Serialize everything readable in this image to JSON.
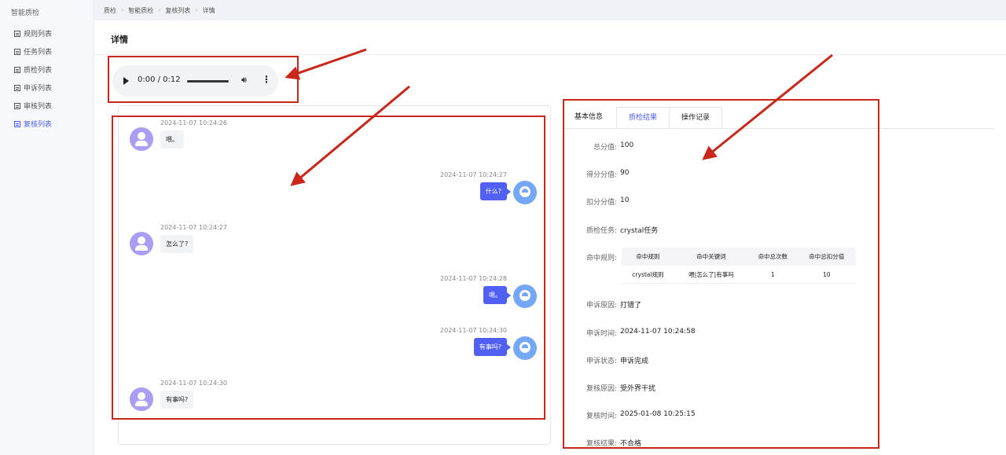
{
  "sidebar": {
    "title": "智能质检",
    "items": [
      {
        "label": "规则列表"
      },
      {
        "label": "任务列表"
      },
      {
        "label": "质检列表"
      },
      {
        "label": "申诉列表"
      },
      {
        "label": "审核列表"
      },
      {
        "label": "复核列表",
        "active": true
      }
    ]
  },
  "breadcrumb": [
    "质检",
    "智能质检",
    "复核列表",
    "详情"
  ],
  "page_title": "详情",
  "audio": {
    "time": "0:00 / 0:12",
    "progress": 0
  },
  "messages": [
    {
      "side": "left",
      "time": "2024-11-07 10:24:26",
      "text": "喂。"
    },
    {
      "side": "right",
      "time": "2024-11-07 10:24:27",
      "text": "什么?"
    },
    {
      "side": "left",
      "time": "2024-11-07 10:24:27",
      "text": "怎么了?"
    },
    {
      "side": "right",
      "time": "2024-11-07 10:24:28",
      "text": "嗯。"
    },
    {
      "side": "right",
      "time": "2024-11-07 10:24:30",
      "text": "有事吗?"
    },
    {
      "side": "left",
      "time": "2024-11-07 10:24:30",
      "text": "有事吗?"
    }
  ],
  "tabs": [
    "基本信息",
    "质检结果",
    "操作记录"
  ],
  "active_tab": "质检结果",
  "result": {
    "total_label": "总分值:",
    "total": "100",
    "score_label": "得分分值:",
    "score": "90",
    "deduct_label": "扣分分值:",
    "deduct": "10",
    "task_label": "质检任务:",
    "task": "crystal任务",
    "rules_label": "命中规则:",
    "rules_table": {
      "headers": [
        "命中规则",
        "命中关键词",
        "命中总次数",
        "命中总扣分值"
      ],
      "rows": [
        [
          "crystal规则",
          "喂|怎么了|有事吗",
          "1",
          "10"
        ]
      ]
    },
    "appeal_reason_label": "申诉原因:",
    "appeal_reason": "打错了",
    "appeal_time_label": "申诉时间:",
    "appeal_time": "2024-11-07 10:24:58",
    "appeal_status_label": "申诉状态:",
    "appeal_status": "申诉完成",
    "review_reason_label": "复核原因:",
    "review_reason": "受外界干扰",
    "review_time_label": "复核时间:",
    "review_time": "2025-01-08 10:25:15",
    "review_result_label": "复核结果:",
    "review_result": "不合格"
  },
  "colors": {
    "accent": "#4e5ff4",
    "annotation": "#c8271a",
    "bubble_agent": "#5160f2"
  }
}
